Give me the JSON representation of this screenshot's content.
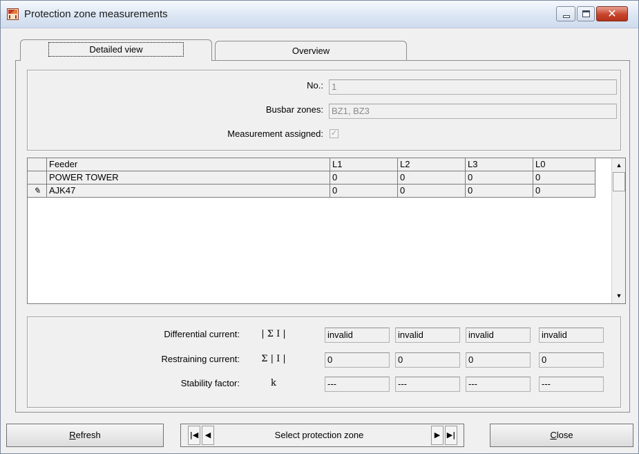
{
  "window": {
    "title": "Protection zone measurements",
    "close_glyph": "✕"
  },
  "tabs": [
    {
      "label": "Detailed view",
      "active": true
    },
    {
      "label": "Overview",
      "active": false
    }
  ],
  "details": {
    "no_label": "No.:",
    "no_value": "1",
    "busbar_label": "Busbar zones:",
    "busbar_value": "BZ1, BZ3",
    "assigned_label": "Measurement assigned:",
    "assigned_checked": true,
    "check_glyph": "✓"
  },
  "feeder_table": {
    "columns": [
      "Feeder",
      "L1",
      "L2",
      "L3",
      "L0"
    ],
    "rows": [
      {
        "marker": "",
        "feeder": "POWER TOWER",
        "l1": "0",
        "l2": "0",
        "l3": "0",
        "l0": "0"
      },
      {
        "marker": "✎",
        "feeder": "AJK47",
        "l1": "0",
        "l2": "0",
        "l3": "0",
        "l0": "0"
      }
    ],
    "scroll_up": "▲",
    "scroll_down": "▼"
  },
  "measurements": {
    "diff_label": "Differential current:",
    "diff_symbol": "| Σ I |",
    "diff_values": [
      "invalid",
      "invalid",
      "invalid",
      "invalid"
    ],
    "restr_label": "Restraining current:",
    "restr_symbol": "Σ | I |",
    "restr_values": [
      "0",
      "0",
      "0",
      "0"
    ],
    "stab_label": "Stability factor:",
    "stab_symbol": "k",
    "stab_values": [
      "---",
      "---",
      "---",
      "---"
    ]
  },
  "footer": {
    "refresh_first": "R",
    "refresh_rest": "efresh",
    "first_glyph": "|◀",
    "prev_glyph": "◀",
    "select_label": "Select protection zone",
    "next_glyph": "▶",
    "last_glyph": "▶|",
    "close_first": "C",
    "close_rest": "lose"
  }
}
